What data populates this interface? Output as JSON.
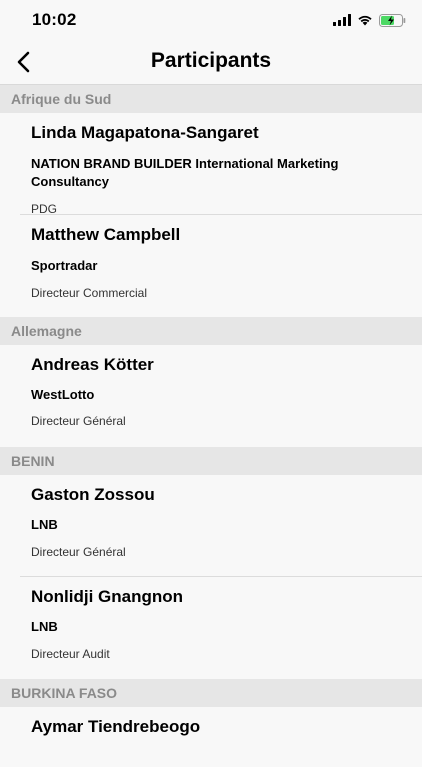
{
  "status": {
    "time": "10:02"
  },
  "nav": {
    "title": "Participants"
  },
  "sections": [
    {
      "country": "Afrique du Sud",
      "people": [
        {
          "name": "Linda Magapatona-Sangaret",
          "company": "NATION BRAND BUILDER International Marketing Consultancy",
          "role": "PDG"
        },
        {
          "name": "Matthew Campbell",
          "company": "Sportradar",
          "role": "Directeur Commercial"
        }
      ]
    },
    {
      "country": "Allemagne",
      "people": [
        {
          "name": "Andreas Kötter",
          "company": "WestLotto",
          "role": "Directeur Général"
        }
      ]
    },
    {
      "country": "BENIN",
      "people": [
        {
          "name": "Gaston Zossou",
          "company": "LNB",
          "role": "Directeur Général"
        },
        {
          "name": "Nonlidji Gnangnon",
          "company": "LNB",
          "role": "Directeur Audit"
        }
      ]
    },
    {
      "country": "BURKINA FASO",
      "people": [
        {
          "name": "Aymar Tiendrebeogo"
        }
      ]
    }
  ]
}
